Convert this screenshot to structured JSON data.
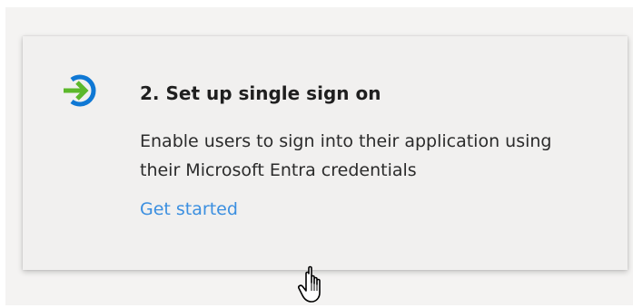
{
  "card": {
    "title": "2. Set up single sign on",
    "description": "Enable users to sign into their application using their Microsoft Entra credentials",
    "link_label": "Get started",
    "icon": "sign-in-arrow-icon"
  },
  "cursor": {
    "icon": "hand-pointer-cursor-icon"
  },
  "colors": {
    "icon_ring": "#0f78d4",
    "icon_arrow": "#5cb82b",
    "link": "#3b8fe0",
    "title": "#1f1f1f",
    "card_background": "#f1f0ef"
  }
}
